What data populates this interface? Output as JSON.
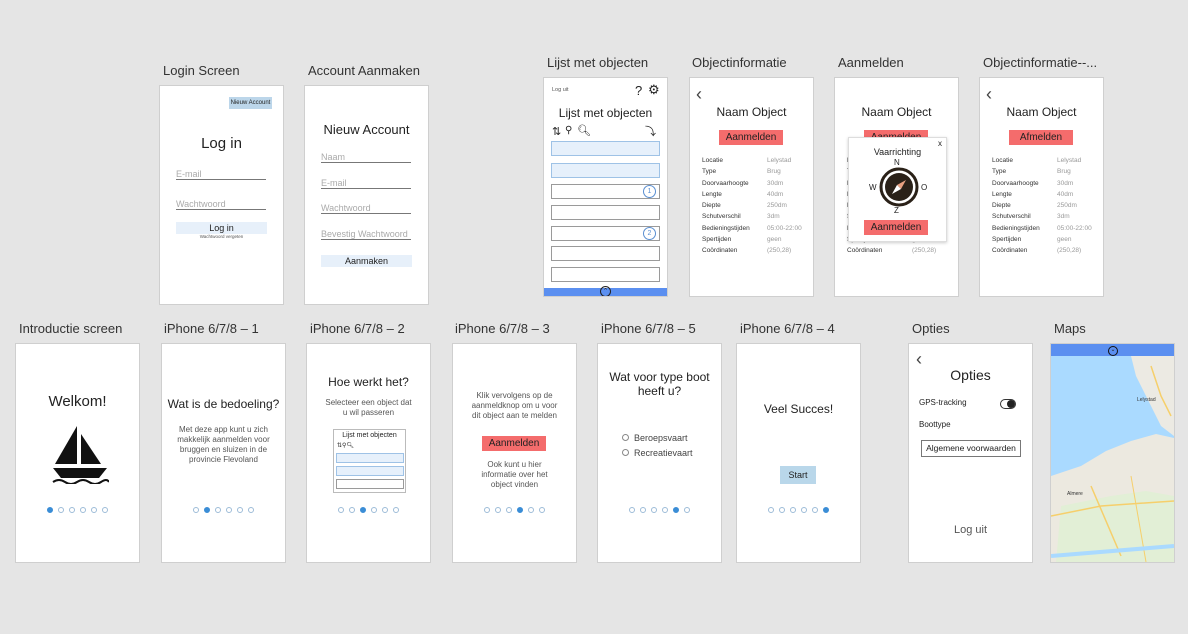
{
  "labels": {
    "login": "Login Screen",
    "account": "Account Aanmaken",
    "lijst": "Lijst met objecten",
    "objinfo": "Objectinformatie",
    "aanmelden": "Aanmelden",
    "objinfo2": "Objectinformatie--...",
    "intro": "Introductie screen",
    "iphone1": "iPhone 6/7/8 – 1",
    "iphone2": "iPhone 6/7/8 – 2",
    "iphone3": "iPhone 6/7/8 – 3",
    "iphone5": "iPhone 6/7/8 – 5",
    "iphone4": "iPhone 6/7/8 – 4",
    "opties": "Opties",
    "maps": "Maps"
  },
  "login": {
    "new_account": "Nieuw Account",
    "title": "Log in",
    "email_placeholder": "E-mail",
    "password_placeholder": "Wachtwoord",
    "login_button": "Log in",
    "forgot": "Wachtwoord vergeten"
  },
  "account": {
    "title": "Nieuw Account",
    "name_placeholder": "Naam",
    "email_placeholder": "E-mail",
    "password_placeholder": "Wachtwoord",
    "confirm_placeholder": "Bevestig Wachtwoord",
    "create_button": "Aanmaken"
  },
  "lijst": {
    "logout": "Log uit",
    "help": "?",
    "title": "Lijst met objecten",
    "badge1": "1",
    "badge2": "2"
  },
  "object": {
    "name": "Naam Object",
    "register": "Aanmelden",
    "deregister": "Afmelden",
    "fields": [
      "Locatie",
      "Type",
      "Doorvaarhoogte",
      "Lengte",
      "Diepte",
      "Schutverschil",
      "Bedieningstijden",
      "Spertijden",
      "Coördinaten"
    ],
    "values": [
      "Lelystad",
      "Brug",
      "30dm",
      "40dm",
      "250dm",
      "3dm",
      "05:00-22:00",
      "geen",
      "(250,28)"
    ]
  },
  "aanmelden_popup": {
    "title": "Vaarrichting",
    "close": "x",
    "n": "N",
    "w": "W",
    "o": "O",
    "z": "Z",
    "button": "Aanmelden"
  },
  "intro": {
    "welcome": "Welkom!"
  },
  "iphone1": {
    "title": "Wat is de bedoeling?",
    "body": "Met deze app kunt u zich makkelijk aanmelden voor bruggen en sluizen in de provincie Flevoland"
  },
  "iphone2": {
    "title": "Hoe werkt het?",
    "body": "Selecteer een object dat u wil passeren",
    "mini_title": "Lijst met objecten"
  },
  "iphone3": {
    "body": "Klik vervolgens op de aanmeldknop om u voor dit object aan te melden",
    "button": "Aanmelden",
    "body2": "Ook kunt u hier informatie over het object vinden"
  },
  "iphone5": {
    "title": "Wat voor type boot heeft u?",
    "option1": "Beroepsvaart",
    "option2": "Recreatievaart"
  },
  "iphone4": {
    "title": "Veel Succes!",
    "start": "Start"
  },
  "opties": {
    "title": "Opties",
    "gps": "GPS-tracking",
    "boottype": "Boottype",
    "terms": "Algemene voorwaarden",
    "logout": "Log uit"
  },
  "maps": {
    "lelystad": "Lelystad",
    "almere": "Almere"
  },
  "colors": {
    "accent_red": "#f46c6c",
    "accent_blue": "#5b8ff0",
    "dot_active": "#3a8dd6"
  }
}
